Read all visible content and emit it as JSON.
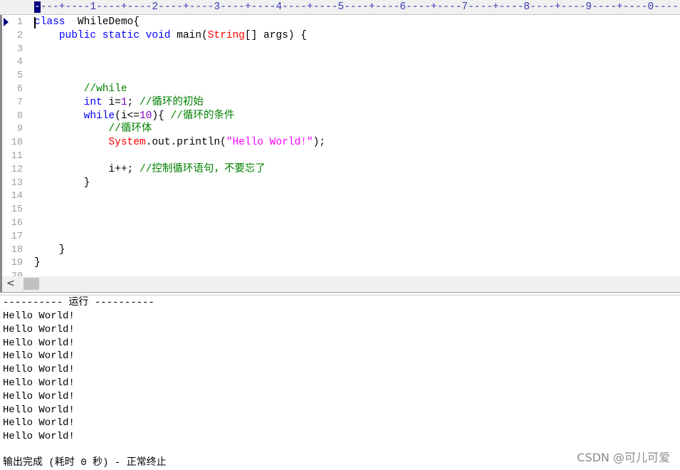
{
  "ruler": {
    "cursor_char": "-",
    "text": "---+----1----+----2----+----3----+----4----+----5----+----6----+----7----+----8----+----9----+----0------"
  },
  "colors": {
    "keyword": "#0000ff",
    "type": "#ff0000",
    "number": "#8000c0",
    "string": "#ff00ff",
    "comment": "#008000",
    "plain": "#000000",
    "caret_marker": "#000080"
  },
  "editor": {
    "lines": [
      {
        "n": "1",
        "tokens": [
          {
            "t": "class",
            "c": "keyword"
          },
          {
            "t": "  WhileDemo{",
            "c": "plain"
          }
        ]
      },
      {
        "n": "2",
        "tokens": [
          {
            "t": "    ",
            "c": "plain"
          },
          {
            "t": "public static void",
            "c": "keyword"
          },
          {
            "t": " main(",
            "c": "plain"
          },
          {
            "t": "String",
            "c": "type"
          },
          {
            "t": "[] args) {",
            "c": "plain"
          }
        ]
      },
      {
        "n": "3",
        "tokens": []
      },
      {
        "n": "4",
        "tokens": []
      },
      {
        "n": "5",
        "tokens": []
      },
      {
        "n": "6",
        "tokens": [
          {
            "t": "        ",
            "c": "plain"
          },
          {
            "t": "//while",
            "c": "comment"
          }
        ]
      },
      {
        "n": "7",
        "tokens": [
          {
            "t": "        ",
            "c": "plain"
          },
          {
            "t": "int",
            "c": "keyword"
          },
          {
            "t": " i=",
            "c": "plain"
          },
          {
            "t": "1",
            "c": "number"
          },
          {
            "t": "; ",
            "c": "plain"
          },
          {
            "t": "//循环的初始",
            "c": "comment"
          }
        ]
      },
      {
        "n": "8",
        "tokens": [
          {
            "t": "        ",
            "c": "plain"
          },
          {
            "t": "while",
            "c": "keyword"
          },
          {
            "t": "(i<=",
            "c": "plain"
          },
          {
            "t": "10",
            "c": "number"
          },
          {
            "t": "){ ",
            "c": "plain"
          },
          {
            "t": "//循环的条件",
            "c": "comment"
          }
        ]
      },
      {
        "n": "9",
        "tokens": [
          {
            "t": "            ",
            "c": "plain"
          },
          {
            "t": "//循环体",
            "c": "comment"
          }
        ]
      },
      {
        "n": "10",
        "tokens": [
          {
            "t": "            ",
            "c": "plain"
          },
          {
            "t": "System",
            "c": "type"
          },
          {
            "t": ".out.println(",
            "c": "plain"
          },
          {
            "t": "\"Hello World!\"",
            "c": "string"
          },
          {
            "t": ");",
            "c": "plain"
          }
        ]
      },
      {
        "n": "11",
        "tokens": []
      },
      {
        "n": "12",
        "tokens": [
          {
            "t": "            ",
            "c": "plain"
          },
          {
            "t": "i++; ",
            "c": "plain"
          },
          {
            "t": "//控制循环语句，不要忘了",
            "c": "comment"
          }
        ]
      },
      {
        "n": "13",
        "tokens": [
          {
            "t": "        }",
            "c": "plain"
          }
        ]
      },
      {
        "n": "14",
        "tokens": []
      },
      {
        "n": "15",
        "tokens": []
      },
      {
        "n": "16",
        "tokens": []
      },
      {
        "n": "17",
        "tokens": []
      },
      {
        "n": "18",
        "tokens": [
          {
            "t": "    }",
            "c": "plain"
          }
        ]
      },
      {
        "n": "19",
        "tokens": [
          {
            "t": "}",
            "c": "plain"
          }
        ]
      },
      {
        "n": "20",
        "tokens": []
      }
    ]
  },
  "scrollbar": {
    "left_arrow": "<"
  },
  "output": {
    "header": "---------- 运行 ----------",
    "lines": [
      "Hello World!",
      "Hello World!",
      "Hello World!",
      "Hello World!",
      "Hello World!",
      "Hello World!",
      "Hello World!",
      "Hello World!",
      "Hello World!",
      "Hello World!"
    ],
    "status": "输出完成 (耗时 0 秒) - 正常终止"
  },
  "watermark": "CSDN @可儿可爱"
}
